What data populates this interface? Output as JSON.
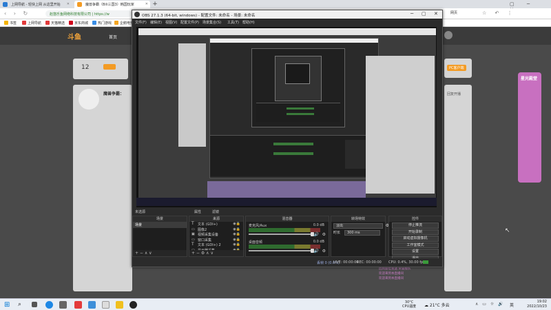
{
  "browser": {
    "tabs": [
      {
        "label": "上网导航 - 轻快上网 从这里开始",
        "active": false
      },
      {
        "label": "魔兽争霸（Bili三国3）韩国玩家",
        "active": true
      }
    ],
    "address": "赵悠乐鱼网络科技有限公司 | https://w",
    "bookmarks": [
      "书签",
      "上网导航",
      "天猫精选",
      "京东商城",
      "热门游戏",
      "企鹅电竞"
    ]
  },
  "site": {
    "logo": "斗鱼",
    "nav_item": "首页",
    "rank_num": "12",
    "profile_title": "魔兽争霸：",
    "right_promo": "星光殿堂",
    "right_badge": "PC客户端",
    "follow_text": "回复开播",
    "chat_lines": [
      "回到座位发送 荣誉舰队",
      "欢迎来到本直播间",
      "欢迎来到本直播间"
    ]
  },
  "obs": {
    "title": "OBS 27.1.3 (64-bit, windows) - 配置文件: 未命名 - 场景: 未命名",
    "menu": [
      "文件(F)",
      "编辑(E)",
      "视图(V)",
      "配置文件(P)",
      "场景集合(S)",
      "工具(T)",
      "帮助(H)"
    ],
    "scene_bar": {
      "label": "未选源",
      "properties": "属性",
      "filters": "滤镜"
    },
    "docks": {
      "scenes": {
        "title": "场景",
        "items": [
          "场景"
        ]
      },
      "sources": {
        "title": "来源",
        "items": [
          "文本 (GDI+)",
          "图像2",
          "视频采集设备",
          "窗口采集",
          "文本 (GDI+) 2",
          "显示器采集"
        ]
      },
      "mixer": {
        "title": "混音器",
        "channels": [
          {
            "name": "麦克风/Aux",
            "db": "0.0 dB"
          },
          {
            "name": "桌面音频",
            "db": "0.0 dB"
          }
        ]
      },
      "transitions": {
        "title": "转场特效",
        "type": "淡出",
        "duration_label": "时长",
        "duration": "300 ms"
      },
      "controls": {
        "title": "控件",
        "buttons": [
          "停止推流",
          "开始录制",
          "启动虚拟摄像机",
          "工作室模式",
          "设置",
          "退出"
        ]
      }
    },
    "status": {
      "dropped": "丢帧 0 (0.0%)",
      "live": "LIVE: 00:00:00",
      "rec": "REC: 00:00:00",
      "cpu": "CPU: 0.4%, 30.00 fps",
      "kbps": "kb/s: 0"
    }
  },
  "taskbar": {
    "weather": "30°C",
    "weather_desc": "CPU温度",
    "temp": "21°C",
    "temp_desc": "多云",
    "lang": "英",
    "time": "19:02",
    "date": "2022/10/23"
  }
}
